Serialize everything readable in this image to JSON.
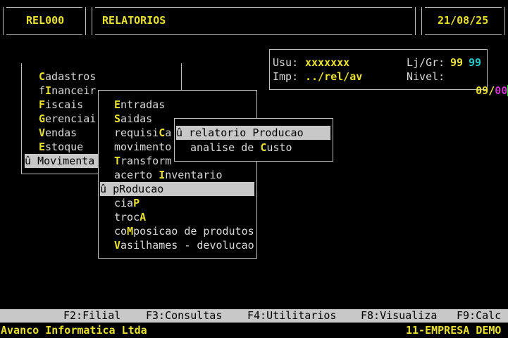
{
  "header": {
    "code": "REL000",
    "title": "RELATORIOS",
    "date": "21/08/25"
  },
  "info": {
    "usu_label": "Usu:",
    "usu_value": "xxxxxxx",
    "lj_label": "Lj/Gr:",
    "lj_value": "99",
    "gr_value": "99",
    "imp_label": "Imp:",
    "imp_value": "../rel/av",
    "nivel_label": "Nivel:",
    "nivel_value": "09",
    "nivel_sep": "/",
    "nivel_value2": "00"
  },
  "main_menu": {
    "items": [
      {
        "hot": "C",
        "rest": "adastros",
        "pre": ""
      },
      {
        "pre": "f",
        "hot": "I",
        "rest": "nanceir"
      },
      {
        "hot": "F",
        "rest": "iscais",
        "pre": ""
      },
      {
        "hot": "G",
        "rest": "erenciai",
        "pre": ""
      },
      {
        "hot": "V",
        "rest": "endas",
        "pre": ""
      },
      {
        "hot": "E",
        "rest": "stoque",
        "pre": ""
      },
      {
        "marker": "û",
        "label": "Movimenta",
        "selected": true
      }
    ]
  },
  "sub_menu": {
    "items": [
      {
        "pre": "",
        "hot": "E",
        "rest": "ntradas"
      },
      {
        "pre": "",
        "hot": "S",
        "rest": "aidas"
      },
      {
        "pre": "requisi",
        "hot": "C",
        "rest": "a"
      },
      {
        "pre": "movimento",
        "hot": "",
        "rest": ""
      },
      {
        "pre": "",
        "hot": "T",
        "rest": "ransform"
      },
      {
        "pre": "acerto ",
        "hot": "I",
        "rest": "nventario"
      },
      {
        "marker": "û",
        "label": "pRoducao",
        "selected": true
      },
      {
        "pre": "cia",
        "hot": "P",
        "rest": ""
      },
      {
        "pre": "troc",
        "hot": "A",
        "rest": ""
      },
      {
        "pre": "co",
        "hot": "M",
        "rest": "posicao de produtos"
      },
      {
        "pre": "",
        "hot": "V",
        "rest": "asilhames - devolucao"
      }
    ]
  },
  "sub_sub_menu": {
    "items": [
      {
        "marker": "û",
        "label": "relatorio Producao",
        "selected": true
      },
      {
        "pre": "analise de ",
        "hot": "C",
        "rest": "usto"
      }
    ]
  },
  "function_keys": [
    "F2:Filial",
    "F3:Consultas",
    "F4:Utilitarios",
    "F8:Visualiza",
    "F9:Calc"
  ],
  "status": {
    "company": "Avanco Informatica Ltda",
    "enterprise": "11-EMPRESA DEMO"
  },
  "colors": {
    "background": "#000000",
    "highlight": "#e8e030",
    "accent_cyan": "#22c8c8",
    "accent_magenta": "#cc33cc",
    "selection_bg": "#c8c8c8"
  }
}
